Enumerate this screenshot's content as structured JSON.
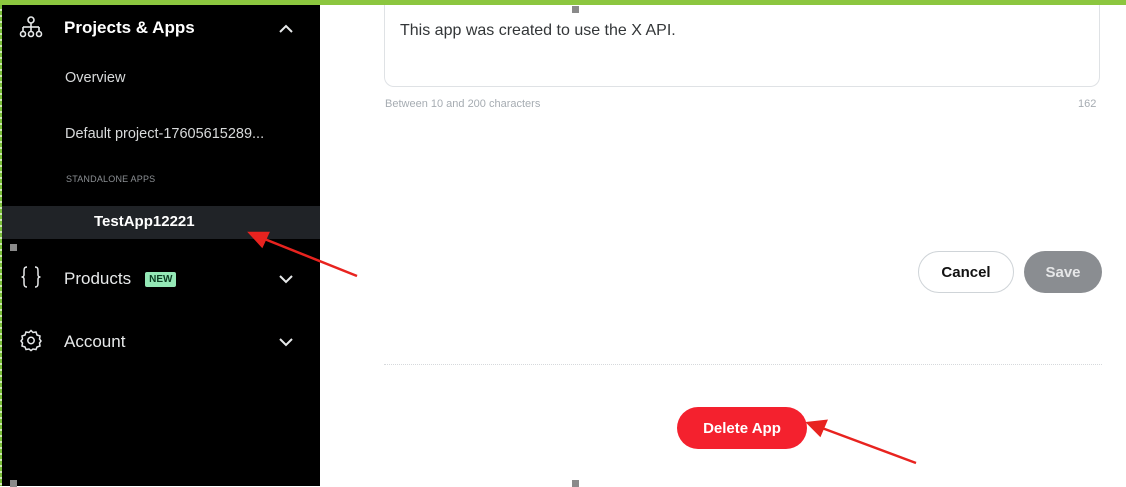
{
  "sidebar": {
    "projects_label": "Projects & Apps",
    "overview_label": "Overview",
    "default_project_label": "Default project-17605615289...",
    "standalone_header": "STANDALONE APPS",
    "selected_app_label": "TestApp12221",
    "products_label": "Products",
    "products_badge": "NEW",
    "account_label": "Account",
    "icons": {
      "projects": "org-chart-icon",
      "products": "braces-icon",
      "account": "gear-icon",
      "projects_chevron": "chevron-up-icon",
      "products_chevron": "chevron-down-icon",
      "account_chevron": "chevron-down-icon"
    }
  },
  "main": {
    "description_value": "This app was created to use the X API.",
    "char_hint": "Between 10 and 200 characters",
    "char_count": "162",
    "cancel_label": "Cancel",
    "save_label": "Save",
    "delete_label": "Delete App"
  },
  "colors": {
    "sidebar_bg": "#000000",
    "selected_item_bg": "#202327",
    "delete_button": "#f4212e",
    "save_button_disabled": "#8a8d91",
    "annotation_arrow": "#e8231f",
    "frame_border": "#8cc63f"
  }
}
